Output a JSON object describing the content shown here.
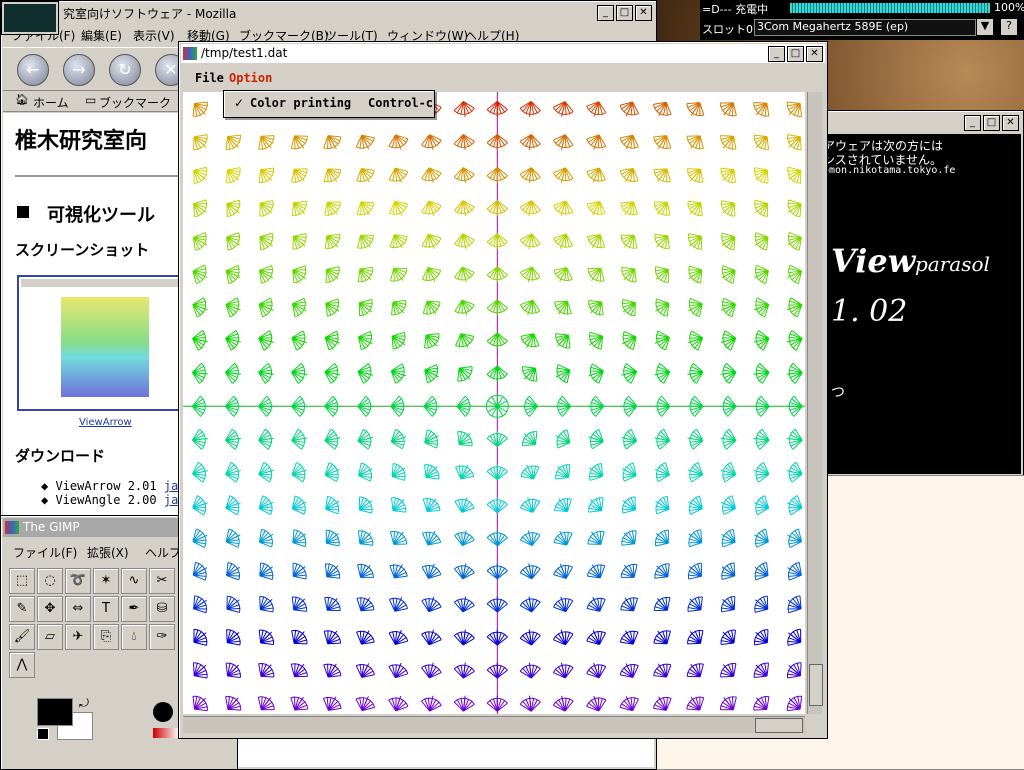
{
  "desktop": {
    "bg": "#3a3a3a"
  },
  "mozilla": {
    "title": "究室向けソフトウェア - Mozilla",
    "menu": [
      "ファイル(F)",
      "編集(E)",
      "表示(V)",
      "移動(G)",
      "ブックマーク(B)",
      "ツール(T)",
      "ウィンドウ(W)",
      "ヘルプ(H)"
    ],
    "nav_nav": [
      "←",
      "→",
      "↻",
      "✕"
    ],
    "personal_bar": {
      "home": "ホーム",
      "bookmarks": "ブックマーク"
    },
    "page_heading": "椎木研究室向",
    "section_heading": "可視化ツール",
    "screenshot_heading": "スクリーンショット",
    "thumb_caption": "ViewArrow",
    "download_heading": "ダウンロード",
    "downloads": [
      {
        "name": "ViewArrow 2.01",
        "link": "jar"
      },
      {
        "name": "ViewAngle 2.00",
        "link": "jar"
      }
    ]
  },
  "viewer": {
    "title": "/tmp/test1.dat",
    "menu": {
      "file": "File",
      "option": "Option"
    },
    "option_menu": {
      "check": "✓",
      "label": "Color printing",
      "shortcut": "Control-c"
    },
    "grid": {
      "cols": 19,
      "rows": 19
    }
  },
  "apm": {
    "battery_text": "=D---  充電中",
    "battery_percent": "100%",
    "battery_level": 1.0,
    "slot_label": "スロット0",
    "slot_value": "3Com Megahertz 589E (ep)"
  },
  "terminal": {
    "lines": [
      "アウェアは次の方には",
      "ンスされていません。",
      "omon.nikotama.tokyo.fe"
    ],
    "app_name": "View",
    "app_sub": "parasol",
    "version": "1. 02",
    "trailing": "つ"
  },
  "gimp": {
    "title": "The GIMP",
    "menu": [
      "ファイル(F)",
      "拡張(X)",
      "ヘルプ"
    ]
  }
}
